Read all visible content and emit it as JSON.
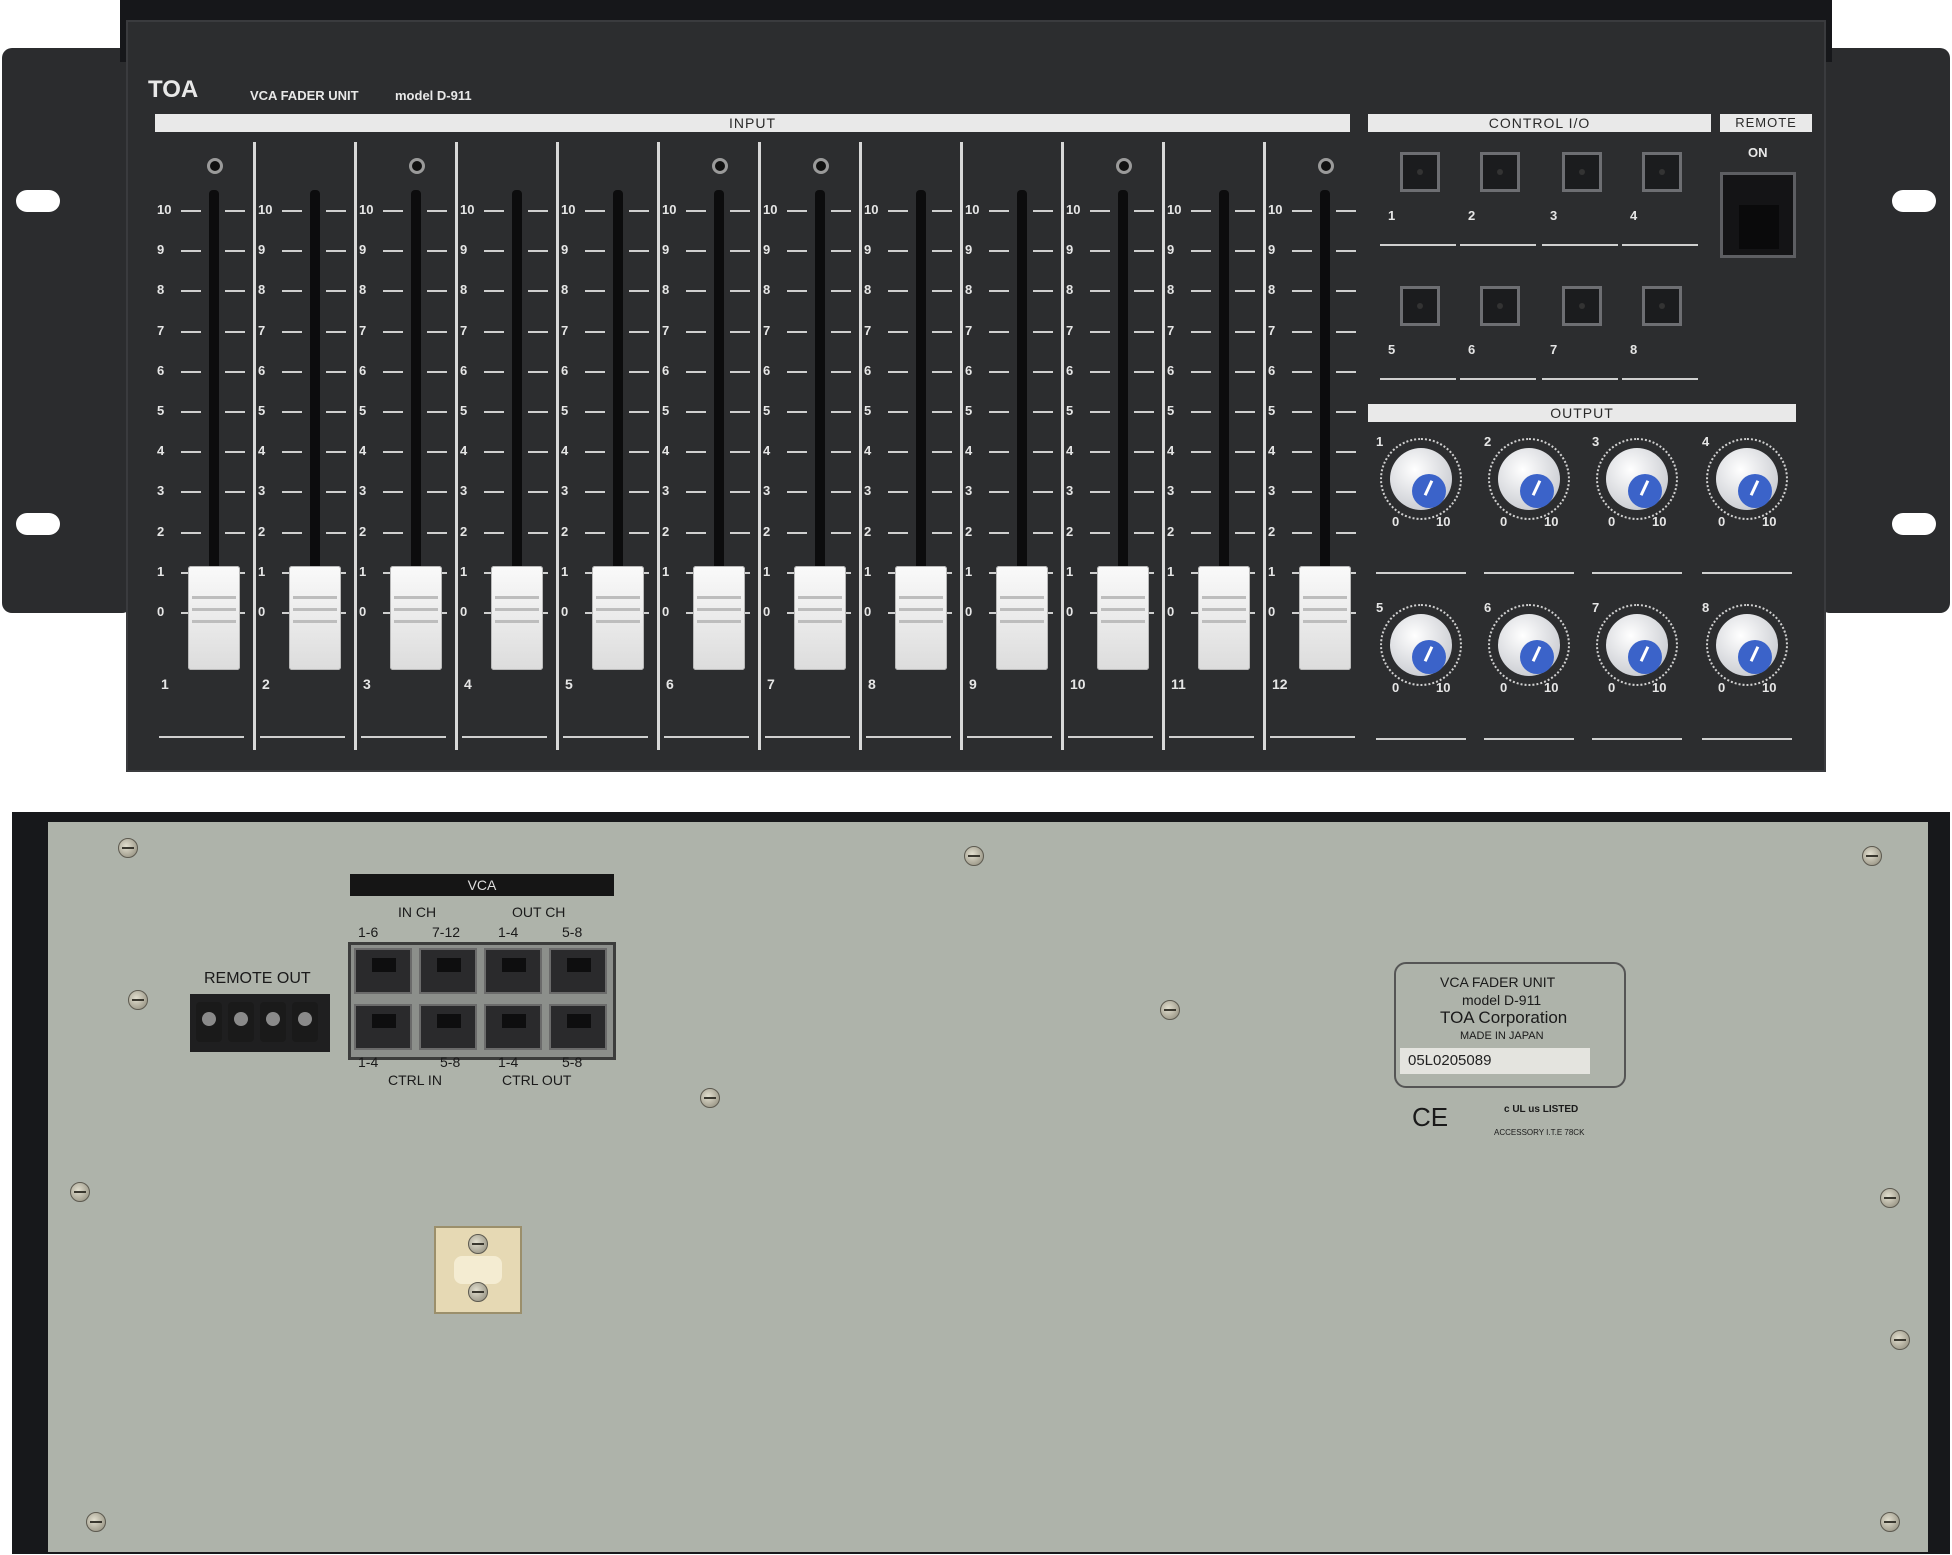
{
  "front": {
    "brand": "TOA",
    "unit_name": "VCA  FADER  UNIT",
    "model": "model  D-911",
    "input_header": "INPUT",
    "control_header": "CONTROL  I/O",
    "remote_header": "REMOTE",
    "remote_switch_label": "ON",
    "output_header": "OUTPUT",
    "scale": [
      "10",
      "9",
      "8",
      "7",
      "6",
      "5",
      "4",
      "3",
      "2",
      "1",
      "0"
    ],
    "channels": [
      "1",
      "2",
      "3",
      "4",
      "5",
      "6",
      "7",
      "8",
      "9",
      "10",
      "11",
      "12"
    ],
    "control_buttons_row1": [
      "1",
      "2",
      "3",
      "4"
    ],
    "control_buttons_row2": [
      "5",
      "6",
      "7",
      "8"
    ],
    "outputs_row1": [
      "1",
      "2",
      "3",
      "4"
    ],
    "outputs_row2": [
      "5",
      "6",
      "7",
      "8"
    ],
    "knob_min": "0",
    "knob_max": "10"
  },
  "rear": {
    "vca_label": "VCA",
    "in_ch": "IN CH",
    "out_ch": "OUT CH",
    "in_ch_ranges": [
      "1-6",
      "7-12"
    ],
    "out_ch_ranges": [
      "1-4",
      "5-8"
    ],
    "ctrl_in_ranges": [
      "1-4",
      "5-8"
    ],
    "ctrl_out_ranges": [
      "1-4",
      "5-8"
    ],
    "ctrl_in": "CTRL  IN",
    "ctrl_out": "CTRL  OUT",
    "remote_out": "REMOTE  OUT",
    "label_unit": "VCA  FADER  UNIT",
    "label_model": "model  D-911",
    "label_company": "TOA Corporation",
    "label_origin": "MADE  IN  JAPAN",
    "serial": "05L0205089",
    "ce_mark": "CE",
    "ul_mark": "c UL us LISTED",
    "ul_sub": "ACCESSORY  I.T.E  78CK"
  }
}
